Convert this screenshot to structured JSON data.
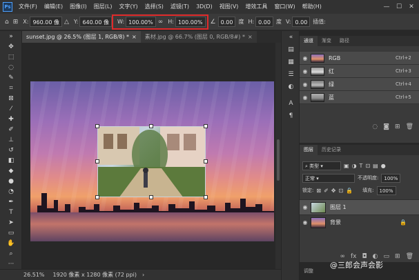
{
  "menu": {
    "logo": "Ps",
    "items": [
      "文件(F)",
      "编辑(E)",
      "图像(I)",
      "图层(L)",
      "文字(Y)",
      "选择(S)",
      "滤镜(T)",
      "3D(D)",
      "视图(V)",
      "增效工具",
      "窗口(W)",
      "帮助(H)"
    ],
    "window_controls": [
      "—",
      "☐",
      "✕"
    ]
  },
  "options": {
    "x_label": "X:",
    "x_value": "960.00 像",
    "y_label": "Y:",
    "y_value": "640.00 像",
    "w_label": "W:",
    "w_value": "100.00%",
    "link_icon": "∞",
    "h_label": "H:",
    "h_value": "100.00%",
    "angle_value": "0.00",
    "angle_unit": "度",
    "hskew_label": "H:",
    "hskew_value": "0.00",
    "hskew_unit": "度",
    "vskew_label": "V:",
    "vskew_value": "0.00",
    "interp_label": "插值:"
  },
  "tabs": [
    {
      "label": "sunset.jpg @ 26.5% (图层 1, RGB/8) *",
      "close": "×"
    },
    {
      "label": "素材.jpg @ 66.7% (图层 0, RGB/8#) *",
      "close": "×"
    }
  ],
  "status": {
    "zoom": "26.51%",
    "doc_info": "1920 像素 x 1280 像素 (72 ppi)",
    "arrow": "›"
  },
  "channels_panel": {
    "tabs": [
      "通道",
      "渐变",
      "路径"
    ],
    "rows": [
      {
        "name": "RGB",
        "shortcut": "Ctrl+2"
      },
      {
        "name": "红",
        "shortcut": "Ctrl+3"
      },
      {
        "name": "绿",
        "shortcut": "Ctrl+4"
      },
      {
        "name": "蓝",
        "shortcut": "Ctrl+5"
      }
    ]
  },
  "layers_panel": {
    "tabs": [
      "图层",
      "历史记录"
    ],
    "filter_label": "类型",
    "blend_mode": "正常",
    "opacity_label": "不透明度:",
    "opacity_value": "100%",
    "lock_label": "锁定:",
    "fill_label": "填充:",
    "fill_value": "100%",
    "layers": [
      {
        "name": "图层 1"
      },
      {
        "name": "背景"
      }
    ]
  },
  "bottom_panel_label": "调整",
  "watermark": "@三郎会声会影",
  "colors": {
    "highlight": "#e02a2a",
    "foreground": "#000000",
    "background": "#ffffff"
  }
}
